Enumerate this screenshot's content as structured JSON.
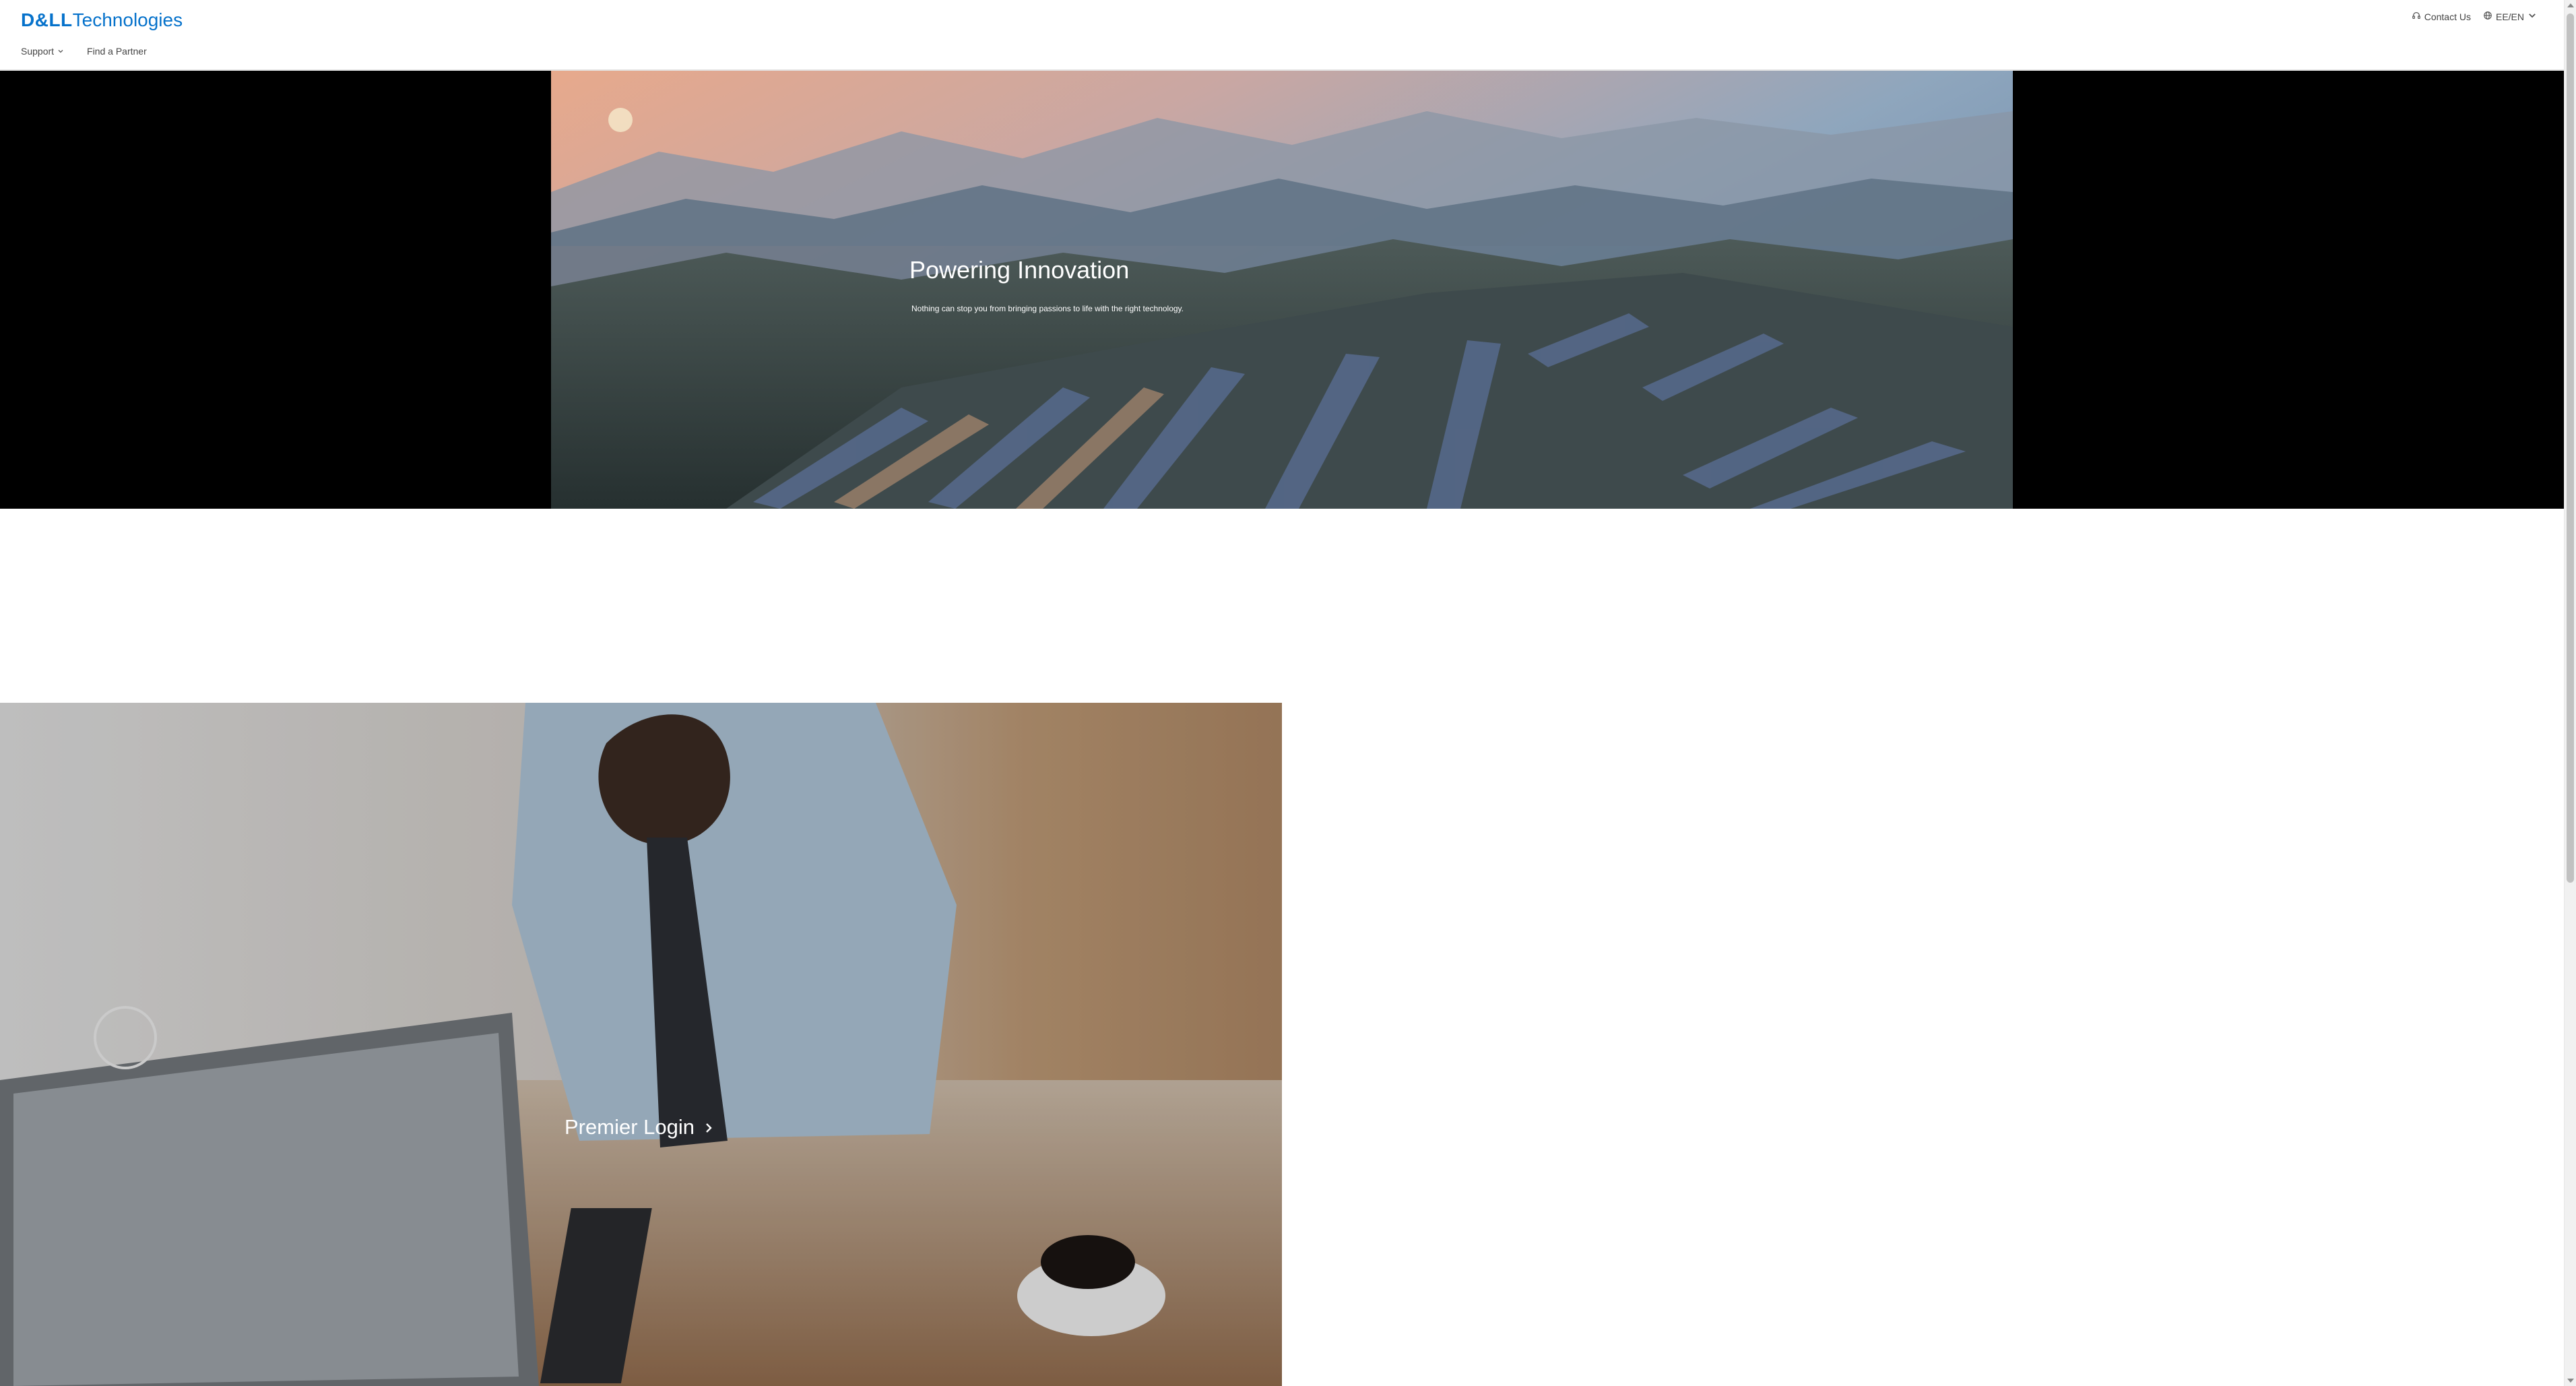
{
  "brand": {
    "logo_bold": "D&LL",
    "logo_light": "Technologies",
    "color": "#0672cb"
  },
  "header": {
    "contact_label": "Contact Us",
    "region_label": "EE/EN"
  },
  "nav": {
    "items": [
      {
        "label": "Support",
        "has_dropdown": true
      },
      {
        "label": "Find a Partner",
        "has_dropdown": false
      }
    ]
  },
  "hero": {
    "title": "Powering Innovation",
    "subtitle": "Nothing can stop you from bringing passions to life with the right technology."
  },
  "premier": {
    "link_label": "Premier Login"
  },
  "icons": {
    "contact": "headset-icon",
    "region": "globe-icon",
    "dropdown": "chevron-down-icon",
    "premier_arrow": "chevron-right-icon"
  }
}
